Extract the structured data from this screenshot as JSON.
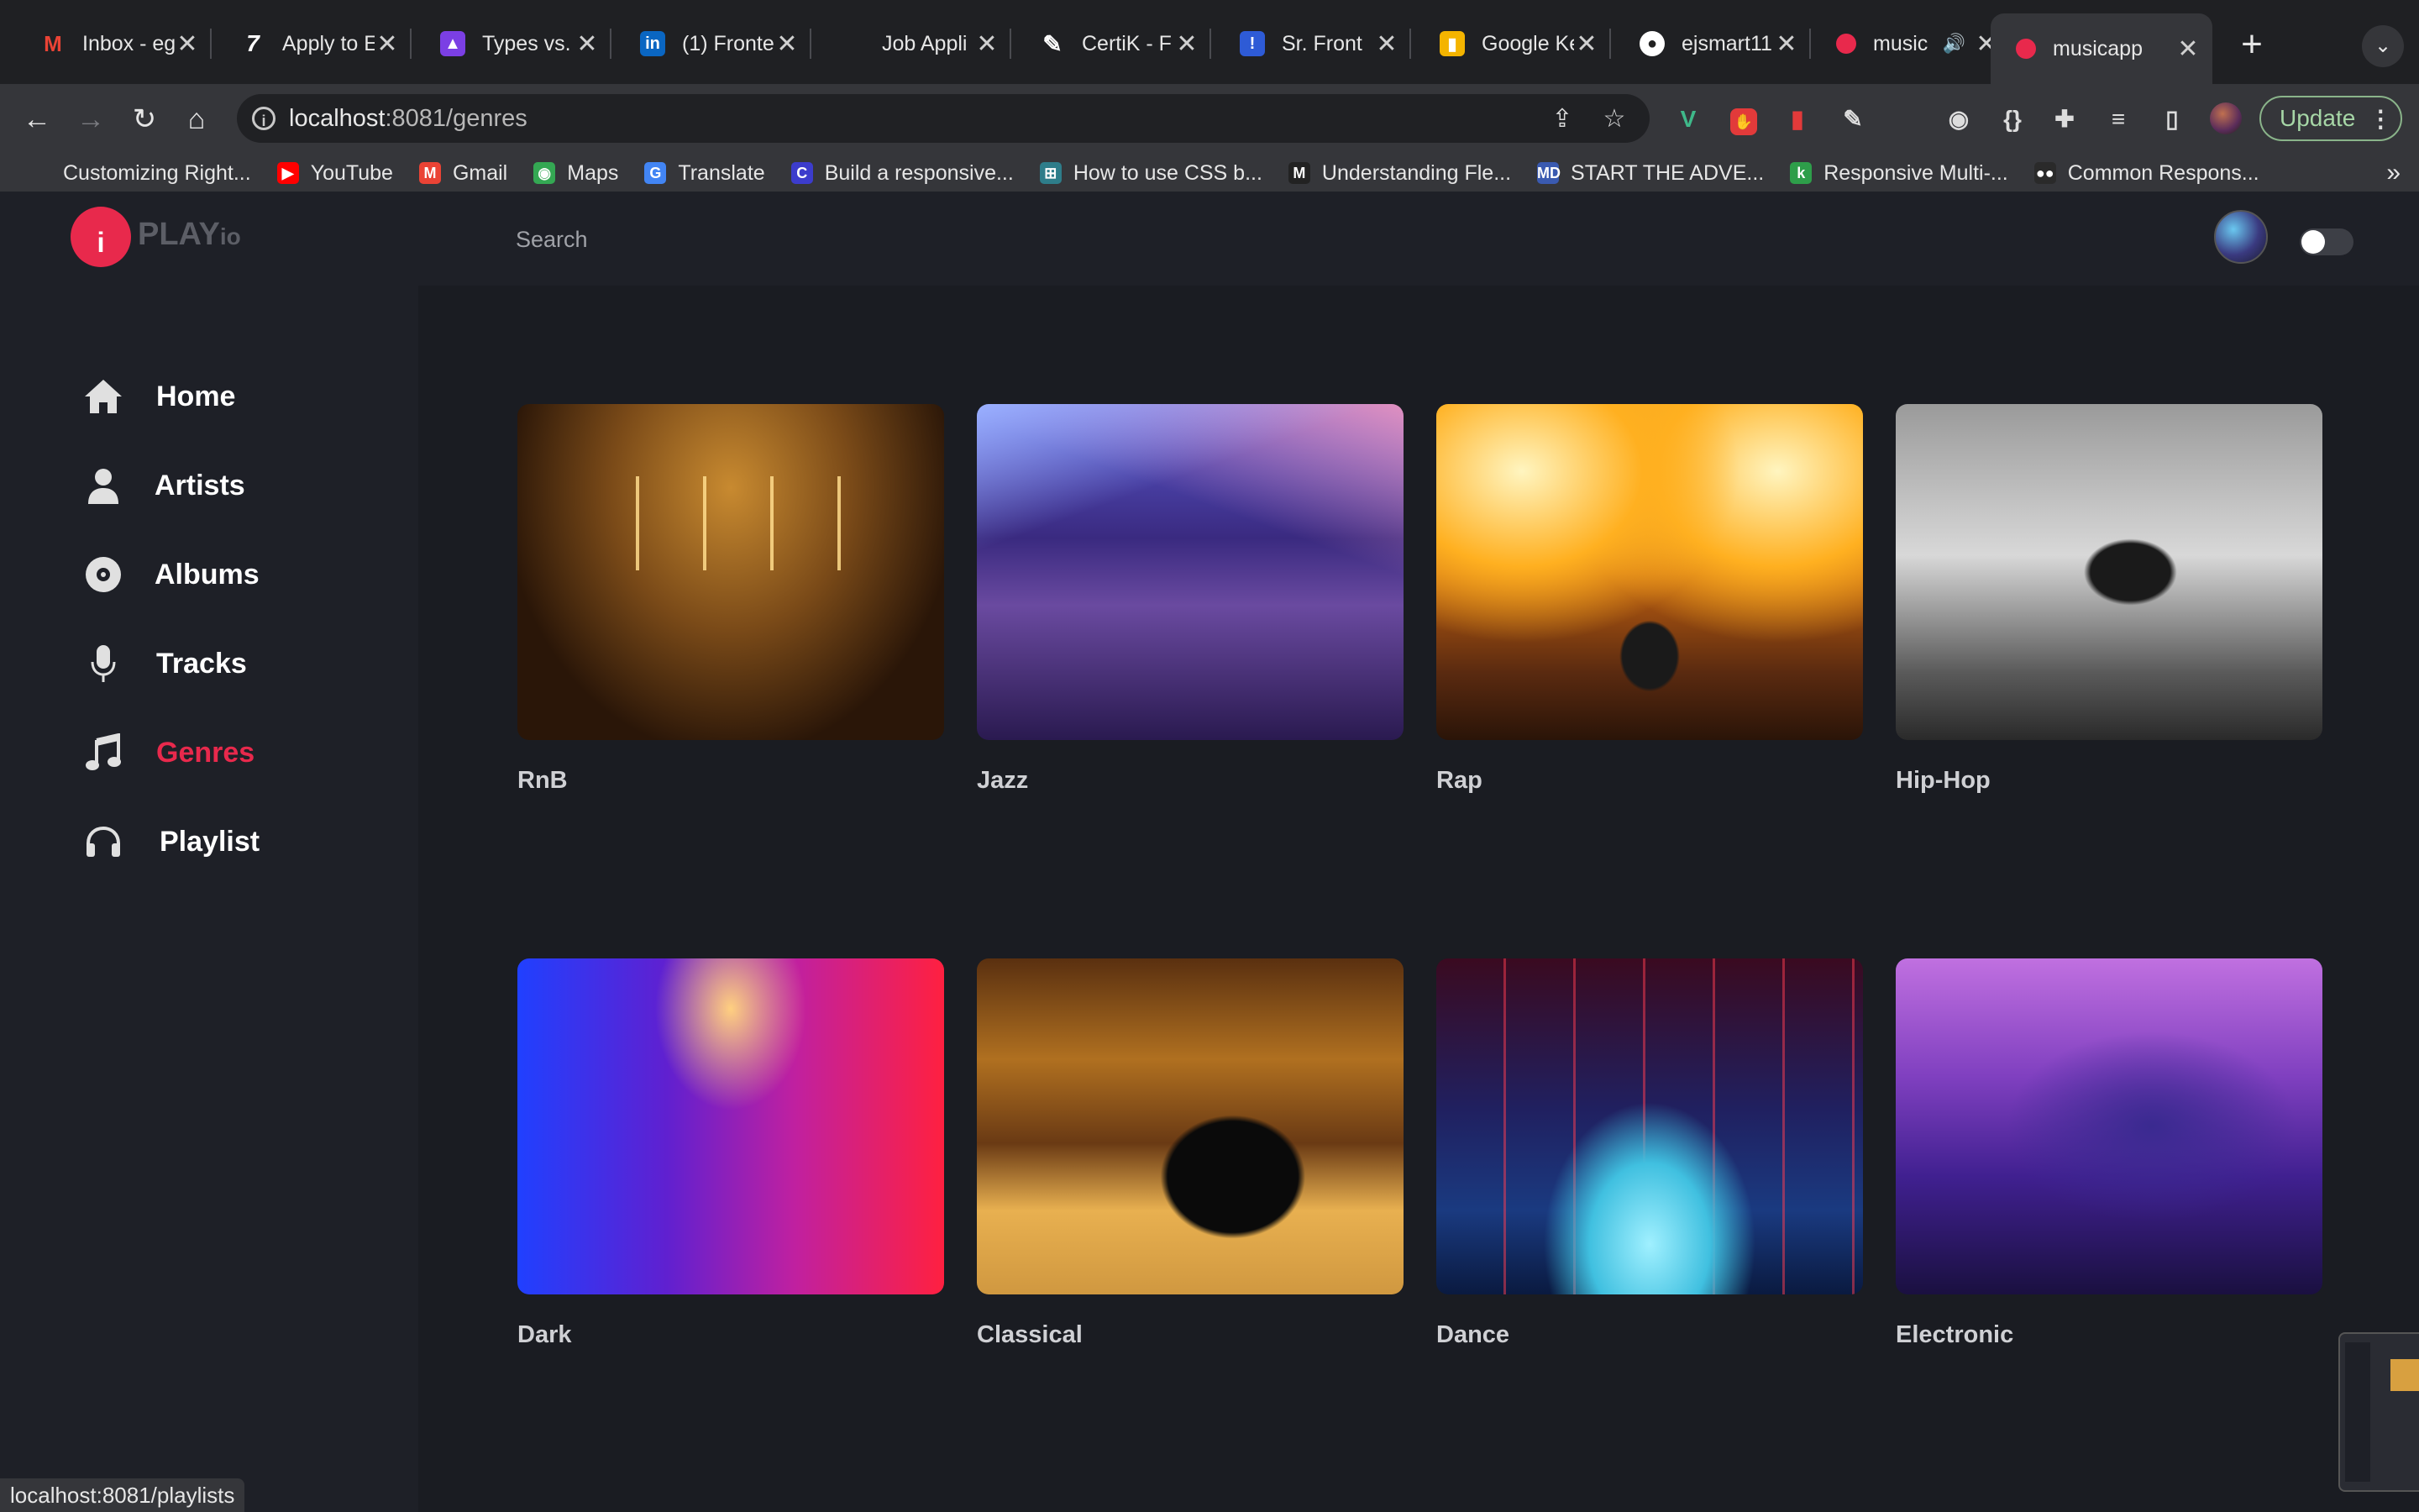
{
  "browser": {
    "tabs": [
      {
        "title": "Inbox - eg",
        "favicon": "gmail-icon",
        "color": "#ea4335",
        "glyph": "M",
        "active": false
      },
      {
        "title": "Apply to E",
        "favicon": "lever-icon",
        "color": "#2a2a2a",
        "glyph": "7",
        "active": false
      },
      {
        "title": "Types vs.",
        "favicon": "rocket-icon",
        "color": "#7b3fe4",
        "glyph": "▲",
        "active": false
      },
      {
        "title": "(1) Fronte",
        "favicon": "linkedin-icon",
        "color": "#0a66c2",
        "glyph": "in",
        "active": false
      },
      {
        "title": "Job Appli",
        "favicon": "blank-icon",
        "color": "#1f2023",
        "glyph": "",
        "active": false
      },
      {
        "title": "CertiK - F",
        "favicon": "pen-icon",
        "color": "#3a3a3a",
        "glyph": "✎",
        "active": false
      },
      {
        "title": "Sr. Front",
        "favicon": "alert-icon",
        "color": "#2e5bd6",
        "glyph": "!",
        "active": false
      },
      {
        "title": "Google Ke",
        "favicon": "keep-icon",
        "color": "#f4b400",
        "glyph": "▮",
        "active": false
      },
      {
        "title": "ejsmart11",
        "favicon": "github-icon",
        "color": "#ffffff",
        "glyph": "●",
        "active": false
      },
      {
        "title": "music",
        "favicon": "musicapp-icon",
        "color": "#e8294c",
        "glyph": "●",
        "active": false,
        "audio": "🔊"
      },
      {
        "title": "musicapp",
        "favicon": "musicapp-icon",
        "color": "#e8294c",
        "glyph": "●",
        "active": true
      }
    ],
    "new_tab": "+",
    "tab_search": "⌄",
    "url_host": "localhost",
    "url_rest": ":8081/genres",
    "update_label": "Update",
    "bookmarks": [
      {
        "label": "Customizing Right...",
        "icon": "",
        "color": ""
      },
      {
        "label": "YouTube",
        "icon": "▶",
        "color": "#ff0000"
      },
      {
        "label": "Gmail",
        "icon": "M",
        "color": "#ea4335"
      },
      {
        "label": "Maps",
        "icon": "◉",
        "color": "#34a853"
      },
      {
        "label": "Translate",
        "icon": "G",
        "color": "#4285f4"
      },
      {
        "label": "Build a responsive...",
        "icon": "C",
        "color": "#3c3ccc"
      },
      {
        "label": "How to use CSS b...",
        "icon": "⊞",
        "color": "#2e7d8a"
      },
      {
        "label": "Understanding Fle...",
        "icon": "M",
        "color": "#222222"
      },
      {
        "label": "START THE ADVE...",
        "icon": "MD",
        "color": "#3a5ab0"
      },
      {
        "label": "Responsive Multi-...",
        "icon": "k",
        "color": "#2e9e4a"
      },
      {
        "label": "Common Respons...",
        "icon": "●●",
        "color": "#2a2a2a"
      }
    ],
    "status_url": "localhost:8081/playlists"
  },
  "header": {
    "logo_main": "PLAY",
    "logo_suffix": "io",
    "search_placeholder": "Search"
  },
  "sidebar": {
    "items": [
      {
        "label": "Home",
        "icon": "home-icon",
        "active": false
      },
      {
        "label": "Artists",
        "icon": "user-icon",
        "active": false
      },
      {
        "label": "Albums",
        "icon": "disc-icon",
        "active": false
      },
      {
        "label": "Tracks",
        "icon": "microphone-icon",
        "active": false
      },
      {
        "label": "Genres",
        "icon": "music-note-icon",
        "active": true
      },
      {
        "label": "Playlist",
        "icon": "headphones-icon",
        "active": false
      }
    ]
  },
  "genres": [
    {
      "label": "RnB",
      "image": "concert-crowd-image"
    },
    {
      "label": "Jazz",
      "image": "cocktail-bar-image"
    },
    {
      "label": "Rap",
      "image": "rapper-flames-image"
    },
    {
      "label": "Hip-Hop",
      "image": "bw-concert-image"
    },
    {
      "label": "Dark",
      "image": "neon-club-image"
    },
    {
      "label": "Classical",
      "image": "concert-hall-piano-image"
    },
    {
      "label": "Dance",
      "image": "dance-club-image"
    },
    {
      "label": "Electronic",
      "image": "tunnel-bar-image"
    }
  ],
  "colors": {
    "accent": "#e8294c",
    "background": "#1a1c22",
    "panel": "#1e2027"
  }
}
